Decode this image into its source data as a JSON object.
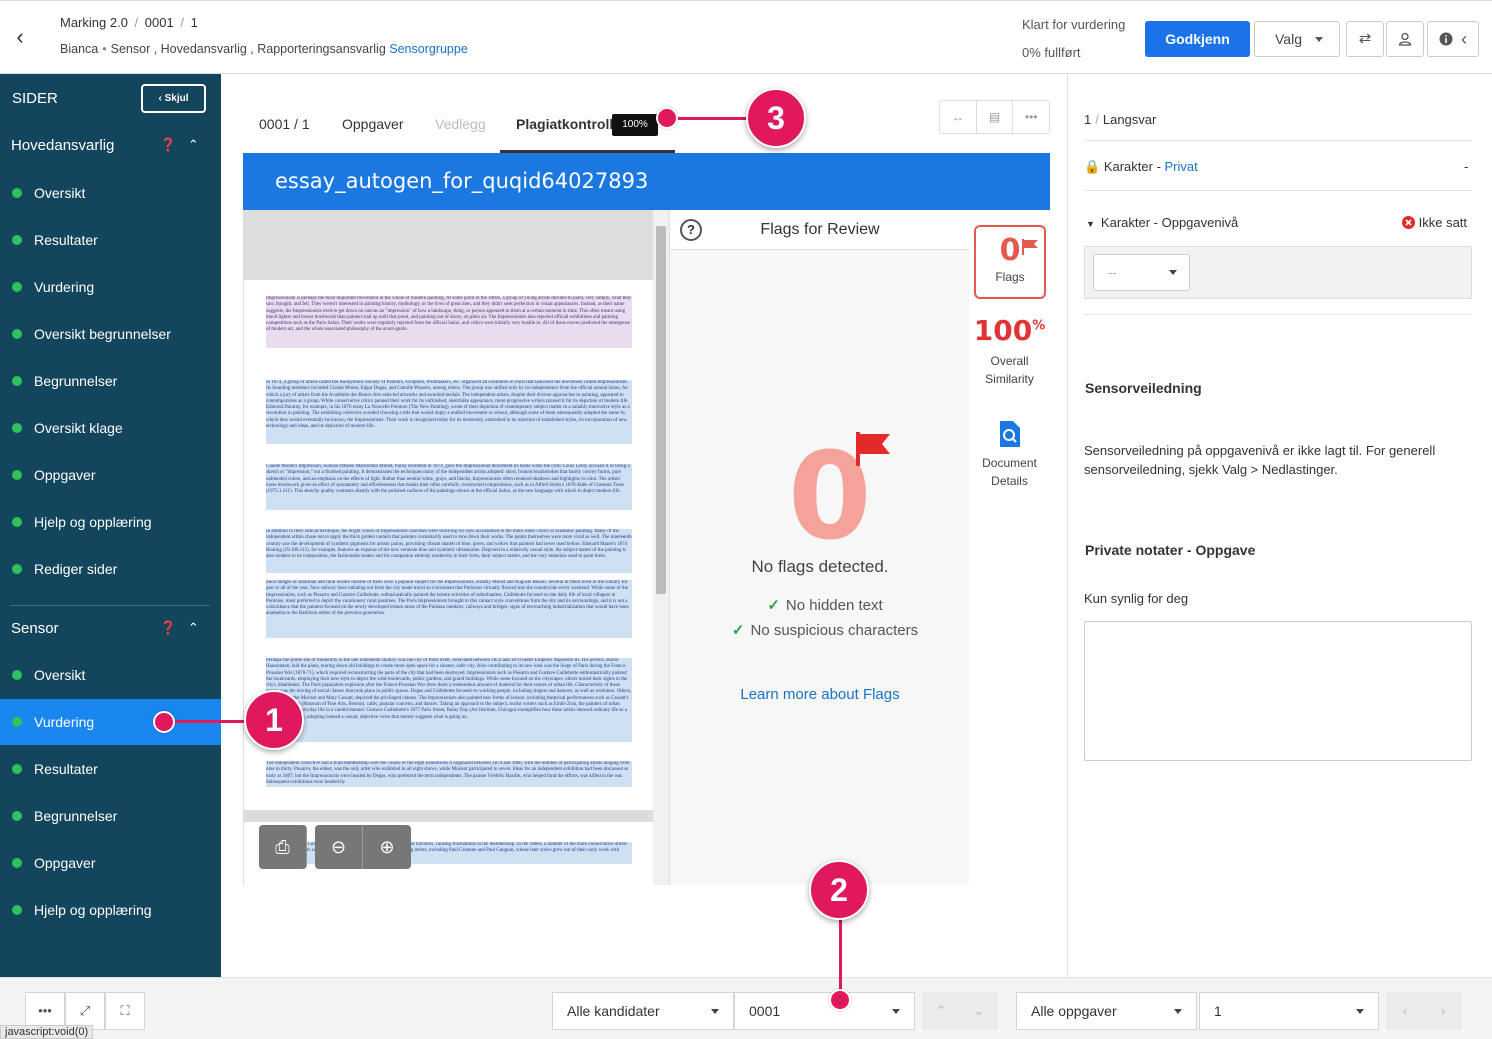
{
  "header": {
    "title_app": "Marking 2.0",
    "title_candidate": "0001",
    "title_index": "1",
    "user": "Bianca",
    "roles": "Sensor , Hovedansvarlig , Rapporteringsansvarlig",
    "group_link": "Sensorgruppe",
    "status": "Klart for vurdering",
    "progress": "0% fullført",
    "approve_label": "Godkjenn",
    "valg_label": "Valg"
  },
  "sidebar": {
    "title": "SIDER",
    "hide_label": "Skjul",
    "groups": [
      {
        "name": "Hovedansvarlig",
        "items": [
          "Oversikt",
          "Resultater",
          "Vurdering",
          "Oversikt begrunnelser",
          "Begrunnelser",
          "Oversikt klage",
          "Oppgaver",
          "Hjelp og opplæring",
          "Rediger sider"
        ]
      },
      {
        "name": "Sensor",
        "items": [
          "Oversikt",
          "Vurdering",
          "Resultater",
          "Begrunnelser",
          "Oppgaver",
          "Hjelp og opplæring"
        ]
      }
    ]
  },
  "tabs": {
    "candidate": "0001 / 1",
    "oppgaver": "Oppgaver",
    "vedlegg": "Vedlegg",
    "plagiat": "Plagiatkontroll",
    "plagiat_badge": "100%"
  },
  "document": {
    "title": "essay_autogen_for_quqid64027893",
    "paragraphs": [
      "Impressionism is perhaps the most important movement in the whole of modern painting. At some point in the 1860s, a group of young artists decided to paint, very simply, what they saw, thought, and felt. They weren't interested in painting history, mythology, or the lives of great men, and they didn't seek perfection in visual appearances. Instead, as their name suggests, the Impressionists tried to get down on canvas an \"impression\" of how a landscape, thing, or person appeared to them at a certain moment in time. This often meant using much lighter and looser brushwork than painters had up until that point, and painting out of doors, on plein air. The Impressionists also rejected official exhibitions and painting competitions such as the Paris Salon. Their works were regularly rejected from the official Salon, and critics were initially very hostile to. All of these moves predicted the emergence of modern art, and the whole associated philosophy of the avant-garde.",
      "In 1874, a group of artists called the Anonymous Society of Painters, Sculptors, Printmakers, etc. organized an exhibition in Paris that launched the movement called Impressionism. Its founding members included Claude Monet, Edgar Degas, and Camille Pissarro, among others. The group was unified only by its independence from the official annual Salon, for which a jury of artists from the Académie des Beaux-Arts selected artworks and awarded medals. The independent artists, despite their diverse approaches to painting, appeared to contemporaries as a group. While conservative critics panned their work for its unfinished, sketchlike appearance, more progressive writers praised it for its depiction of modern life. Edmond Duranty, for example, in his 1876 essay La Nouvelle Peinture (The New Painting), wrote of their depiction of contemporary subject matter in a suitably innovative style as a revolution in painting. The exhibiting collective avoided choosing a title that would imply a unified movement or school, although some of them subsequently adopted the name by which they would eventually be known, the Impressionists. Their work is recognized today for its modernity, embodied in its rejection of established styles, its incorporation of new technology and ideas, and its depiction of modern life.",
      "Claude Monet's Impression, Sunrise (Musée Marmottan Monet, Paris) exhibited in 1874, gave the Impressionist movement its name when the critic Louis Leroy accused it of being a sketch or \"impression,\" not a finished painting. It demonstrates the techniques many of the independent artists adopted: short, broken brushstrokes that barely convey forms, pure unblended colors, and an emphasis on the effects of light. Rather than neutral white, grays, and blacks, Impressionists often rendered shadows and highlights in color. The artists' loose brushwork gives an effect of spontaneity and effortlessness that masks their often carefully constructed compositions, such as in Alfred Sisley's 1878 Allée of Chestnut Trees (1975.1.211). This sketchy quality contrasts sharply with the polished surfaces of the paintings shown at the official Salon, as the new language with which to depict modern life.",
      "In addition to their radical technique, the bright colors of Impressionist canvases were shocking for eyes accustomed to the more sober colors of academic painting. Many of the independent artists chose not to apply the thick golden varnish that painters customarily used to tone down their works. The paints themselves were more vivid as well. The nineteenth century saw the development of synthetic pigments for artists' paints, providing vibrant shades of blue, green, and yellow that painters had never used before. Edouard Manet's 1874 Boating (29.100.115), for example, features an expanse of the new cerulean blue and synthetic ultramarine. Depicted in a relatively casual style, the subject matter of the painting is also modern in its composition, the fashionable boater and his companion embody modernity in their form, their subject matter, and the very materials used to paint them.",
      "Such images of suburban and rural leisure outside of Paris were a popular subject for the Impressionists, notably Monet and Auguste Renoir. Several of them lived in the country for part or all of the year. New railway lines radiating out from the city made travel so convenient that Parisians virtually flocked into the countryside every weekend. While some of the Impressionists, such as Pissarro and Gustave Caillebotte, enthusiastically painted the leisure activities of suburbanites, Caillebotte focused on the daily life of local villagers in Pontoise, most preferred to depict the vacationers' rural pastimes. The Paris Impressionists brought to this contact style conventions from the city and its surroundings, and it is not a coincidence that the painters focused on the newly developed leisure areas of the Parisian outskirts, railways and bridges, signs of encroaching industrialization that would have been anathema to the Barbizon artists of the previous generation.",
      "Perhaps the prime site of modernity in the late nineteenth century was the city of Paris itself, renovated between 1853 and 1870 under Emperor Napoleon III. His prefect, Baron Haussmann, laid the plans, tearing down old buildings to create more open space for a cleaner, safer city. Also contributing to its new look was the Siege of Paris during the Franco-Prussian War (1870-71), which required reconstructing the parts of the city that had been destroyed. Impressionists such as Pissarro and Gustave Caillebotte enthusiastically painted the boulevards, employing their new style to depict the wide boulevards, public gardens, and grand buildings. While some focused on the cityscapes, others turned their sights to the city's inhabitants. The Paris population explosion after the Franco-Prussian War drew them a tremendous amount of material for their scenes of urban life. Characteristic of these scenes was the mixing of social classes that took place in public spaces. Degas and Caillebotte focused on working people, including singers and dancers, as well as workmen. Others, including Berthe Morisot and Mary Cassatt, depicted the privileged classes. The Impressionists also painted new forms of leisure, including theatrical performances such as Cassatt's 1878 In the Loge (Museum of Fine Arts, Boston), cafés, popular concerts, and dances. Taking an approach to the subject, realist writers such as Emile Zola, the painters of urban scenes depicted everyday life in a candid manner. Gustave Caillebotte's 1877 Paris Street, Rainy Day (Art Institute, Chicago) exemplifies how these artists showed ordinary life as a direct subject of art, adopting instead a casual, objective voice that merely suggests what is going on.",
      "The independent collective had a fluid membership over the course of the eight exhibitions it organized between 1874 and 1886, with the number of participating artists ranging from nine to thirty. Pissarro, the eldest, was the only artist who exhibited in all eight shows, while Morisot participated in seven. Ideas for an independent exhibition had been discussed as early as 1867, but the Impressionists were headed by Degas, who preferred the term independents. The painter Frédéric Bazille, who helped fund the efforts, was killed in the war. Subsequent exhibitions were headed by",
      "Renoir, Pissarro and Cézanne, among the artists led to heated disputes and fractures, causing fluctuations in the membership. In the 1880s, a number of the more conservative artists who simply refused to submit their work to the Salon jury. The exhibiting artists, including Paul Cézanne and Paul Gauguin, whose later styles grew out of their early work with"
    ]
  },
  "flags": {
    "header": "Flags for Review",
    "big_count": "0",
    "no_flags_text": "No flags detected.",
    "checks": [
      "No hidden text",
      "No suspicious characters"
    ],
    "learn_more": "Learn more about Flags",
    "card_count": "0",
    "card_label": "Flags",
    "similarity_value": "100",
    "similarity_unit": "%",
    "similarity_label_1": "Overall",
    "similarity_label_2": "Similarity",
    "doc_details_1": "Document",
    "doc_details_2": "Details"
  },
  "right_panel": {
    "task_index": "1",
    "task_type": "Langsvar",
    "grade_private_label": "Karakter",
    "grade_private_link": "Privat",
    "grade_private_value": "-",
    "grade_task_label": "Karakter - Oppgavenivå",
    "grade_task_status": "Ikke satt",
    "grade_select_value": "--",
    "guidance_heading": "Sensorveiledning",
    "guidance_text": "Sensorveiledning på oppgavenivå er ikke lagt til. For generell sensorveiledning, sjekk Valg > Nedlastinger.",
    "notes_heading": "Private notater - Oppgave",
    "notes_hint": "Kun synlig for deg"
  },
  "bottom": {
    "candidates_select": "Alle kandidater",
    "candidate_select": "0001",
    "tasks_select": "Alle oppgaver",
    "task_select": "1",
    "status_link": "javascript:void(0)"
  },
  "callouts": [
    "1",
    "2",
    "3"
  ],
  "colors": {
    "sidebar_bg": "#13455d",
    "sidebar_active": "#1a86f0",
    "status_dot": "#2ec15c",
    "primary": "#1a73e8",
    "callout": "#e0195f",
    "flag_red": "#e35a4f"
  }
}
